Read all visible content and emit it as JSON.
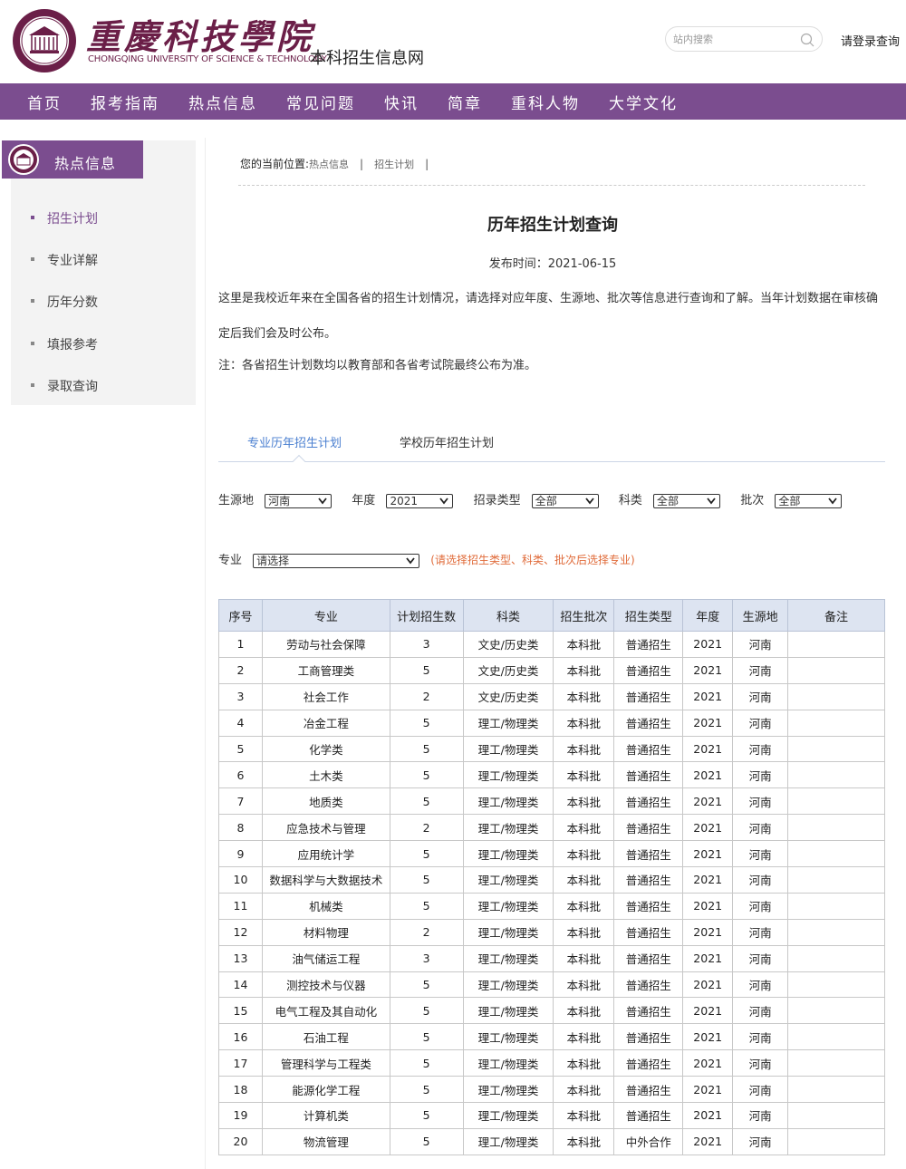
{
  "header": {
    "logo_cn": "重慶科技學院",
    "logo_en": "CHONGQING UNIVERSITY OF SCIENCE & TECHNOLOGY",
    "site_name": "本科招生信息网",
    "search_placeholder": "站内搜索",
    "login_label": "请登录查询"
  },
  "nav": [
    "首页",
    "报考指南",
    "热点信息",
    "常见问题",
    "快讯",
    "简章",
    "重科人物",
    "大学文化"
  ],
  "sidebar": {
    "title": "热点信息",
    "items": [
      "招生计划",
      "专业详解",
      "历年分数",
      "填报参考",
      "录取查询"
    ],
    "active_index": 0
  },
  "breadcrumb": {
    "prefix": "您的当前位置:",
    "items": [
      "热点信息",
      "招生计划"
    ],
    "separator": "|"
  },
  "article": {
    "title": "历年招生计划查询",
    "pub_date": "发布时间：2021-06-15",
    "intro": "这里是我校近年来在全国各省的招生计划情况，请选择对应年度、生源地、批次等信息进行查询和了解。当年计划数据在审核确定后我们会及时公布。",
    "note": "注：各省招生计划数均以教育部和各省考试院最终公布为准。"
  },
  "tabs": [
    "专业历年招生计划",
    "学校历年招生计划"
  ],
  "filters": {
    "source_label": "生源地",
    "source_value": "河南",
    "year_label": "年度",
    "year_value": "2021",
    "type_label": "招录类型",
    "type_value": "全部",
    "subject_label": "科类",
    "subject_value": "全部",
    "batch_label": "批次",
    "batch_value": "全部",
    "major_label": "专业",
    "major_value": "请选择",
    "major_hint": "(请选择招生类型、科类、批次后选择专业)"
  },
  "table": {
    "headers": [
      "序号",
      "专业",
      "计划招生数",
      "科类",
      "招生批次",
      "招生类型",
      "年度",
      "生源地",
      "备注"
    ],
    "rows": [
      [
        "1",
        "劳动与社会保障",
        "3",
        "文史/历史类",
        "本科批",
        "普通招生",
        "2021",
        "河南",
        ""
      ],
      [
        "2",
        "工商管理类",
        "5",
        "文史/历史类",
        "本科批",
        "普通招生",
        "2021",
        "河南",
        ""
      ],
      [
        "3",
        "社会工作",
        "2",
        "文史/历史类",
        "本科批",
        "普通招生",
        "2021",
        "河南",
        ""
      ],
      [
        "4",
        "冶金工程",
        "5",
        "理工/物理类",
        "本科批",
        "普通招生",
        "2021",
        "河南",
        ""
      ],
      [
        "5",
        "化学类",
        "5",
        "理工/物理类",
        "本科批",
        "普通招生",
        "2021",
        "河南",
        ""
      ],
      [
        "6",
        "土木类",
        "5",
        "理工/物理类",
        "本科批",
        "普通招生",
        "2021",
        "河南",
        ""
      ],
      [
        "7",
        "地质类",
        "5",
        "理工/物理类",
        "本科批",
        "普通招生",
        "2021",
        "河南",
        ""
      ],
      [
        "8",
        "应急技术与管理",
        "2",
        "理工/物理类",
        "本科批",
        "普通招生",
        "2021",
        "河南",
        ""
      ],
      [
        "9",
        "应用统计学",
        "5",
        "理工/物理类",
        "本科批",
        "普通招生",
        "2021",
        "河南",
        ""
      ],
      [
        "10",
        "数据科学与大数据技术",
        "5",
        "理工/物理类",
        "本科批",
        "普通招生",
        "2021",
        "河南",
        ""
      ],
      [
        "11",
        "机械类",
        "5",
        "理工/物理类",
        "本科批",
        "普通招生",
        "2021",
        "河南",
        ""
      ],
      [
        "12",
        "材料物理",
        "2",
        "理工/物理类",
        "本科批",
        "普通招生",
        "2021",
        "河南",
        ""
      ],
      [
        "13",
        "油气储运工程",
        "3",
        "理工/物理类",
        "本科批",
        "普通招生",
        "2021",
        "河南",
        ""
      ],
      [
        "14",
        "测控技术与仪器",
        "5",
        "理工/物理类",
        "本科批",
        "普通招生",
        "2021",
        "河南",
        ""
      ],
      [
        "15",
        "电气工程及其自动化",
        "5",
        "理工/物理类",
        "本科批",
        "普通招生",
        "2021",
        "河南",
        ""
      ],
      [
        "16",
        "石油工程",
        "5",
        "理工/物理类",
        "本科批",
        "普通招生",
        "2021",
        "河南",
        ""
      ],
      [
        "17",
        "管理科学与工程类",
        "5",
        "理工/物理类",
        "本科批",
        "普通招生",
        "2021",
        "河南",
        ""
      ],
      [
        "18",
        "能源化学工程",
        "5",
        "理工/物理类",
        "本科批",
        "普通招生",
        "2021",
        "河南",
        ""
      ],
      [
        "19",
        "计算机类",
        "5",
        "理工/物理类",
        "本科批",
        "普通招生",
        "2021",
        "河南",
        ""
      ],
      [
        "20",
        "物流管理",
        "5",
        "理工/物理类",
        "本科批",
        "中外合作",
        "2021",
        "河南",
        ""
      ]
    ]
  },
  "colors": {
    "brand": "#7b4d8f",
    "accent_blue": "#4a7fd0",
    "hint_orange": "#e06b3a",
    "table_header_bg": "#dde4f1"
  }
}
